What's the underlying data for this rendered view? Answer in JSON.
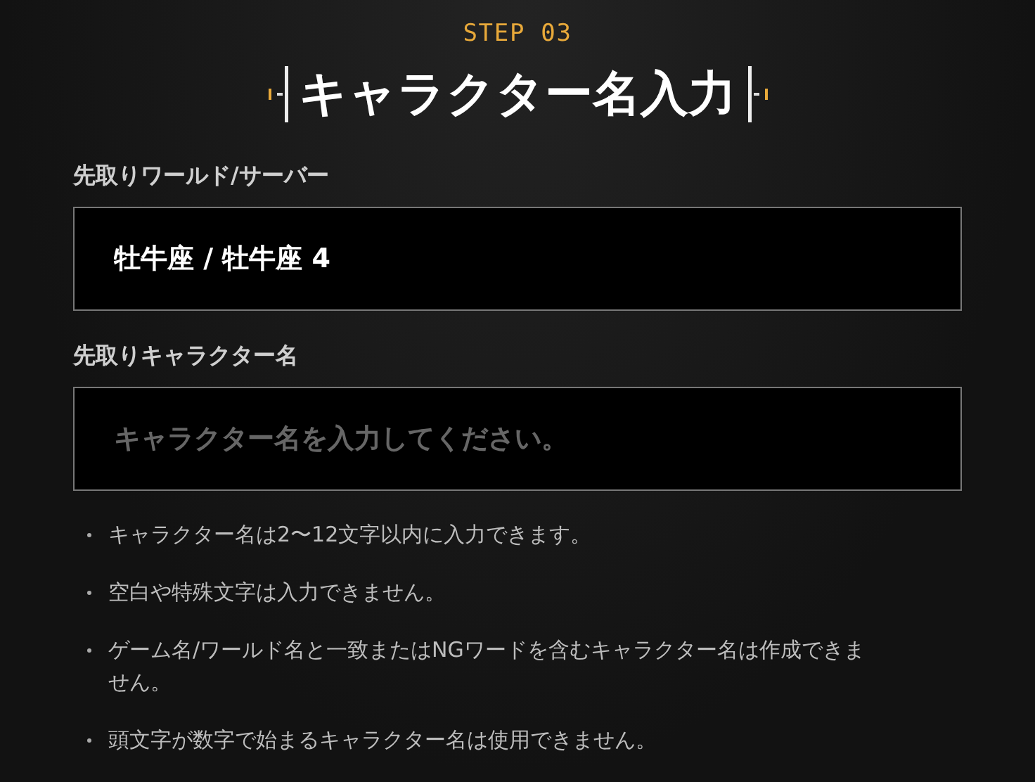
{
  "step": "STEP 03",
  "title": "キャラクター名入力",
  "fields": [
    {
      "label": "先取りワールド/サーバー",
      "value": "牡牛座 / 牡牛座 4"
    },
    {
      "label": "先取りキャラクター名",
      "placeholder": "キャラクター名を入力してください。"
    }
  ],
  "notes": [
    "キャラクター名は2〜12文字以内に入力できます。",
    "空白や特殊文字は入力できません。",
    "ゲーム名/ワールド名と一致またはNGワードを含むキャラクター名は作成できません。",
    "頭文字が数字で始まるキャラクター名は使用できません。"
  ]
}
